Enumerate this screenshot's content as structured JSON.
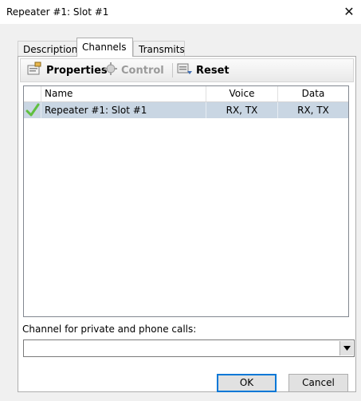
{
  "window": {
    "title": "Repeater #1: Slot #1",
    "close_symbol": "✕"
  },
  "tabs": [
    {
      "label": "Description",
      "active": false
    },
    {
      "label": "Channels",
      "active": true
    },
    {
      "label": "Transmits",
      "active": false
    }
  ],
  "toolbar": {
    "properties_label": "Properties",
    "control_label": "Control",
    "reset_label": "Reset",
    "properties_icon": "properties-icon",
    "control_icon": "control-icon",
    "reset_icon": "reset-icon"
  },
  "table": {
    "columns": [
      "Name",
      "Voice",
      "Data"
    ],
    "rows": [
      {
        "status_icon": "check-icon",
        "name": "Repeater #1: Slot #1",
        "voice": "RX, TX",
        "data": "RX, TX",
        "selected": true
      }
    ]
  },
  "private_calls": {
    "label": "Channel for private and phone calls:",
    "value": ""
  },
  "buttons": {
    "ok_label": "OK",
    "cancel_label": "Cancel"
  },
  "colors": {
    "selection": "#c9d6e3",
    "check": "#5fbf3f"
  }
}
